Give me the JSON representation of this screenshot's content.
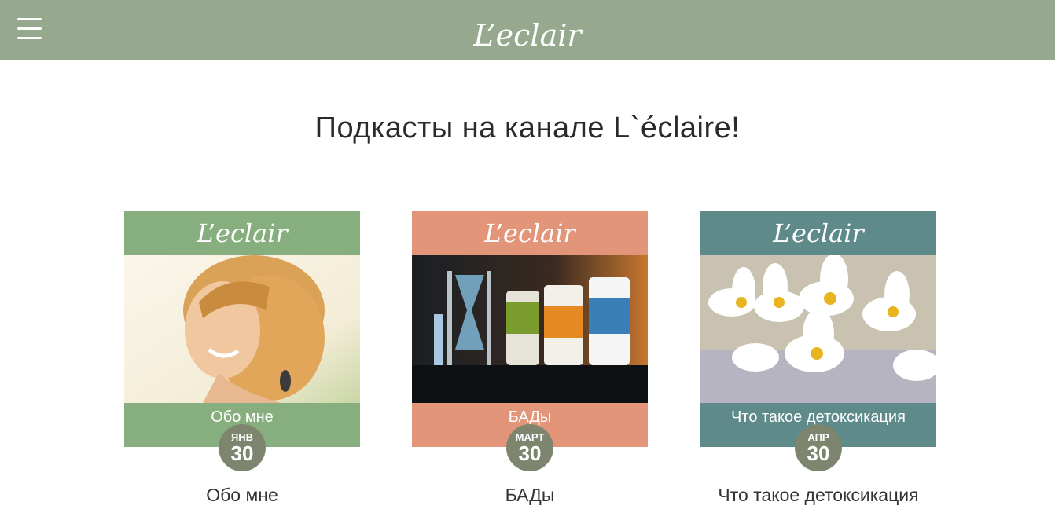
{
  "header": {
    "logo": "L’eclair",
    "menu_icon": "hamburger-icon",
    "background": "#96a98e"
  },
  "page": {
    "title": "Подкасты на канале L`éclaire!"
  },
  "cards": [
    {
      "thumb_logo": "L’eclair",
      "footer_text": "Обо мне",
      "month": "ЯНВ",
      "day": "30",
      "title": "Обо мне",
      "color": "#87ae7e"
    },
    {
      "thumb_logo": "L’eclair",
      "footer_text": "БАДы",
      "month": "МАРТ",
      "day": "30",
      "title": "БАДы",
      "color": "#e3957a"
    },
    {
      "thumb_logo": "L’eclair",
      "footer_text": "Что такое детоксикация",
      "month": "АПР",
      "day": "30",
      "title": "Что такое детоксикация",
      "color": "#5f8a8a"
    }
  ]
}
